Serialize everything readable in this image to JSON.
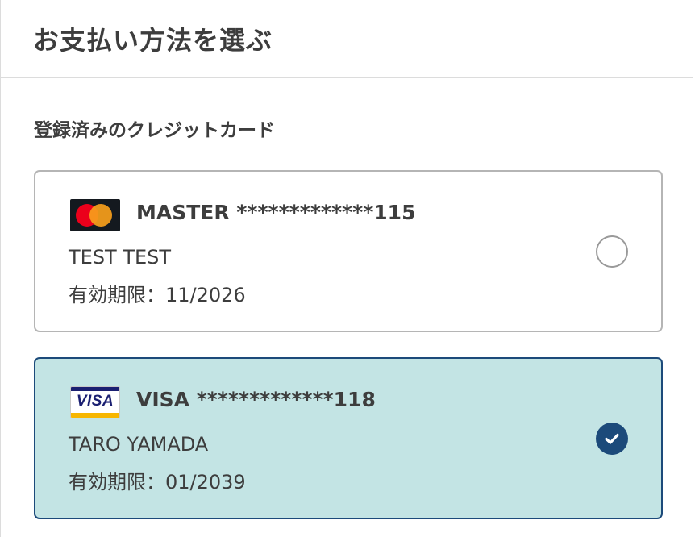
{
  "header": {
    "title": "お支払い方法を選ぶ"
  },
  "section": {
    "title": "登録済みのクレジットカード"
  },
  "cards": [
    {
      "brand": "MASTER",
      "number_label": "MASTER *************115",
      "holder": "TEST TEST",
      "expiry": "有効期限：11/2026",
      "selected": false
    },
    {
      "brand": "VISA",
      "logo_text": "VISA",
      "number_label": "VISA *************118",
      "holder": "TARO YAMADA",
      "expiry": "有効期限：01/2039",
      "selected": true
    }
  ],
  "colors": {
    "selected_bg": "#c3e4e4",
    "selected_border": "#1c4a7a",
    "unselected_border": "#b5b5b5",
    "check_fill": "#1c4a7a"
  },
  "icons": {
    "check": "checkmark-icon",
    "master_logo": "mastercard-logo-icon",
    "visa_logo": "visa-logo-icon"
  }
}
